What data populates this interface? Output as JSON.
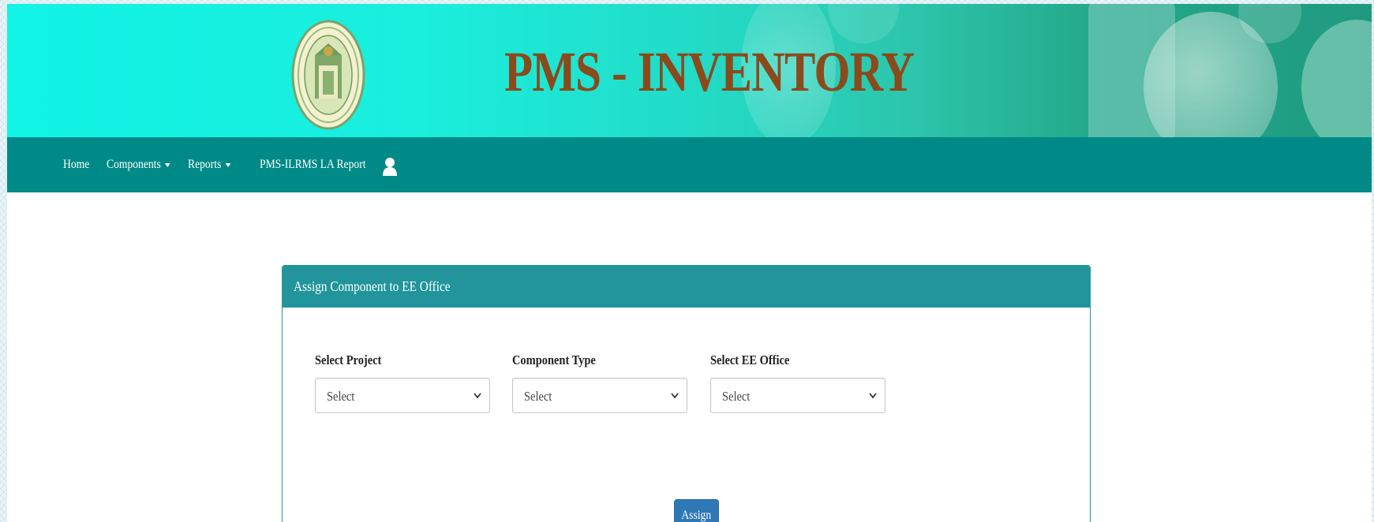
{
  "header": {
    "title": "PMS - INVENTORY",
    "logo_icon": "telangana-emblem-icon",
    "colors": {
      "banner_start": "#11f4e6",
      "title": "#8a4a1c"
    }
  },
  "nav": {
    "items": [
      {
        "label": "Home",
        "has_caret": false
      },
      {
        "label": "Components",
        "has_caret": true
      },
      {
        "label": "Reports",
        "has_caret": true
      },
      {
        "label": "PMS-ILRMS LA Report",
        "has_caret": false
      }
    ],
    "user_icon": "user-icon",
    "background": "#008a87"
  },
  "form": {
    "heading": "Assign Component to EE Office",
    "fields": [
      {
        "label": "Select Project",
        "value": "Select"
      },
      {
        "label": "Component Type",
        "value": "Select"
      },
      {
        "label": "Select EE Office",
        "value": "Select"
      }
    ],
    "assign_label": "Assign",
    "heading_color": "#21959b",
    "button_color": "#2e78b5"
  }
}
